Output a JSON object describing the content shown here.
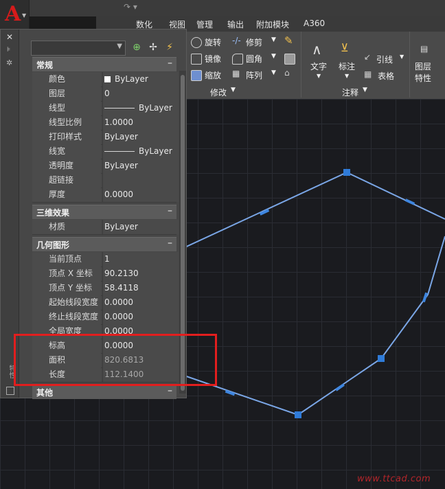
{
  "app": {
    "logo_letter": "A",
    "qat_symbols": "↷ ▾"
  },
  "ribbon_tabs": [
    "数化",
    "视图",
    "管理",
    "输出",
    "附加模块",
    "A360"
  ],
  "ribbon": {
    "modify": [
      "旋转",
      "修剪",
      "镜像",
      "圆角",
      "缩放",
      "阵列"
    ],
    "modify_title": "修改",
    "text_label": "文字",
    "dim_label": "标注",
    "leader_label": "引线",
    "table_label": "表格",
    "annot_title": "注释",
    "layer_props_1": "图层",
    "layer_props_2": "特性"
  },
  "palette": {
    "side_label": "特性",
    "sections": [
      {
        "title": "常规",
        "rows": [
          {
            "k": "颜色",
            "v": "ByLayer",
            "swatch": true
          },
          {
            "k": "图层",
            "v": "0"
          },
          {
            "k": "线型",
            "v": "ByLayer",
            "line": true
          },
          {
            "k": "线型比例",
            "v": "1.0000"
          },
          {
            "k": "打印样式",
            "v": "ByLayer"
          },
          {
            "k": "线宽",
            "v": "ByLayer",
            "line": true
          },
          {
            "k": "透明度",
            "v": "ByLayer"
          },
          {
            "k": "超链接",
            "v": ""
          },
          {
            "k": "厚度",
            "v": "0.0000"
          }
        ]
      },
      {
        "title": "三维效果",
        "rows": [
          {
            "k": "材质",
            "v": "ByLayer"
          }
        ]
      },
      {
        "title": "几何图形",
        "rows": [
          {
            "k": "当前顶点",
            "v": "1"
          },
          {
            "k": "顶点 X 坐标",
            "v": "90.2130"
          },
          {
            "k": "顶点 Y 坐标",
            "v": "58.4118"
          },
          {
            "k": "起始线段宽度",
            "v": "0.0000"
          },
          {
            "k": "终止线段宽度",
            "v": "0.0000"
          },
          {
            "k": "全局宽度",
            "v": "0.0000"
          },
          {
            "k": "标高",
            "v": "0.0000"
          },
          {
            "k": "面积",
            "v": "820.6813",
            "dim": true
          },
          {
            "k": "长度",
            "v": "112.1400",
            "dim": true
          }
        ]
      },
      {
        "title": "其他",
        "rows": []
      }
    ]
  },
  "watermark": "www.ttcad.com",
  "colors": {
    "polyline": "#7aa6e6",
    "grip": "#2f7bd8",
    "highlight": "#e21e1e"
  }
}
